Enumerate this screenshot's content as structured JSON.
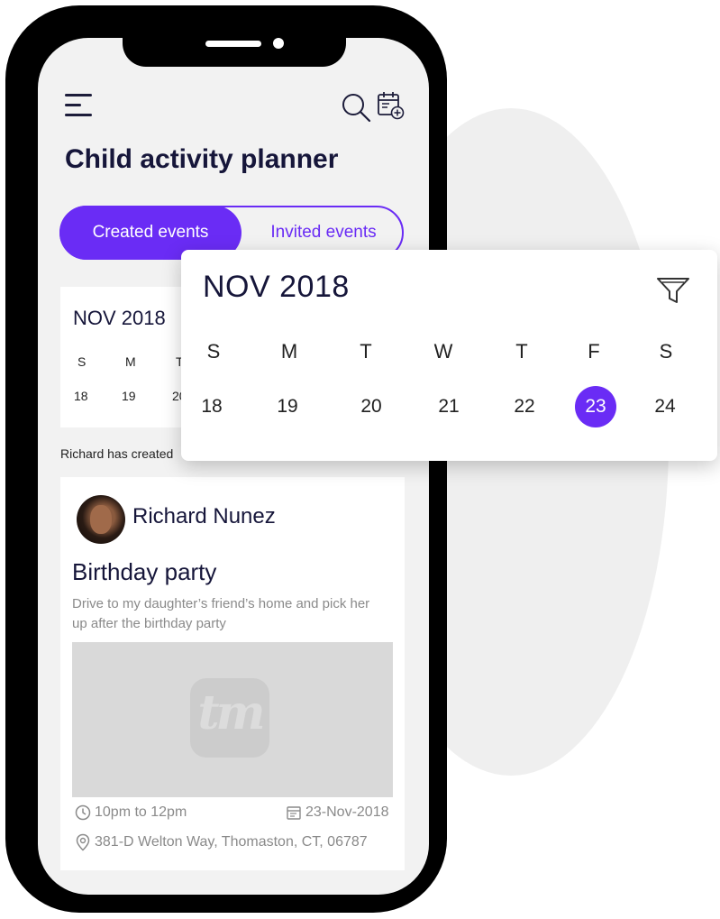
{
  "app": {
    "title": "Child activity planner"
  },
  "tabs": [
    {
      "label": "Created events",
      "active": true
    },
    {
      "label": "Invited events",
      "active": false
    }
  ],
  "mini_calendar": {
    "month": "NOV 2018",
    "days_of_week": [
      "S",
      "M",
      "T"
    ],
    "dates": [
      "18",
      "19",
      "20"
    ]
  },
  "summary_text": "Richard has created",
  "event_card": {
    "author": "Richard Nunez",
    "title": "Birthday party",
    "description": "Drive to my daughter’s friend’s home and pick her up after the birthday party",
    "image_logo_text": "tm",
    "time": "10pm to 12pm",
    "date": "23-Nov-2018",
    "location": "381-D Welton Way, Thomaston, CT, 06787"
  },
  "calendar_popup": {
    "month": "NOV 2018",
    "days_of_week": [
      "S",
      "M",
      "T",
      "W",
      "T",
      "F",
      "S"
    ],
    "dates": [
      {
        "day": "18",
        "selected": false
      },
      {
        "day": "19",
        "selected": false
      },
      {
        "day": "20",
        "selected": false
      },
      {
        "day": "21",
        "selected": false
      },
      {
        "day": "22",
        "selected": false
      },
      {
        "day": "23",
        "selected": true
      },
      {
        "day": "24",
        "selected": false
      }
    ]
  },
  "icons": {
    "menu": "hamburger-menu-icon",
    "search": "search-icon",
    "add_event": "calendar-add-icon",
    "filter": "filter-icon",
    "time": "clock-icon",
    "date": "calendar-icon",
    "location": "location-pin-icon"
  },
  "colors": {
    "accent": "#6a2cf5",
    "title_text": "#16163a",
    "muted_text": "#8a8a8a",
    "screen_bg": "#f2f2f2"
  }
}
